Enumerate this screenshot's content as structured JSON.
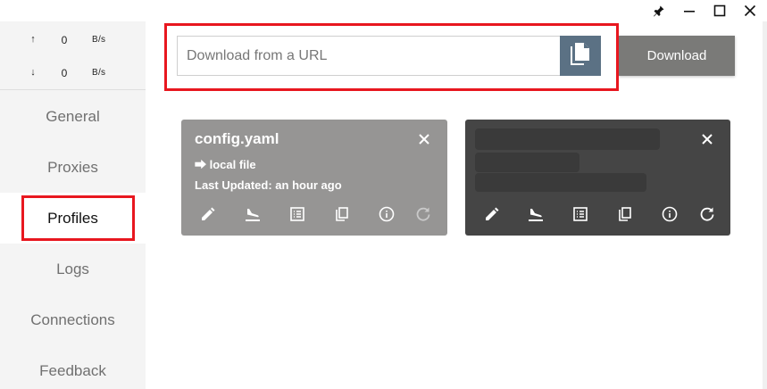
{
  "window": {
    "title_icons": [
      "pin-icon",
      "minimize-icon",
      "maximize-icon",
      "close-icon"
    ]
  },
  "traffic": {
    "up_arrow": "↑",
    "up_value": "0",
    "up_unit": "B/s",
    "down_arrow": "↓",
    "down_value": "0",
    "down_unit": "B/s"
  },
  "sidebar": {
    "items": [
      {
        "label": "General"
      },
      {
        "label": "Proxies"
      },
      {
        "label": "Profiles"
      },
      {
        "label": "Logs"
      },
      {
        "label": "Connections"
      },
      {
        "label": "Feedback"
      }
    ],
    "active": "Profiles"
  },
  "download": {
    "placeholder": "Download from a URL",
    "value": "",
    "button_label": "Download"
  },
  "profiles": [
    {
      "name": "config.yaml",
      "type": "⮕ local file",
      "updated": "Last Updated: an hour ago",
      "selected": false,
      "actions": [
        "edit-icon",
        "plane-landing-icon",
        "list-icon",
        "copy-icon",
        "info-icon",
        "refresh-icon"
      ]
    },
    {
      "name": "",
      "type": "",
      "updated": "",
      "selected": true,
      "actions": [
        "edit-icon",
        "plane-landing-icon",
        "list-icon",
        "copy-icon",
        "info-icon",
        "refresh-icon"
      ]
    }
  ],
  "colors": {
    "annotation": "#e8171f",
    "paste_button": "#5b7184",
    "download_button": "#7a7a78",
    "card_light": "#969594",
    "card_dark": "#454545"
  }
}
